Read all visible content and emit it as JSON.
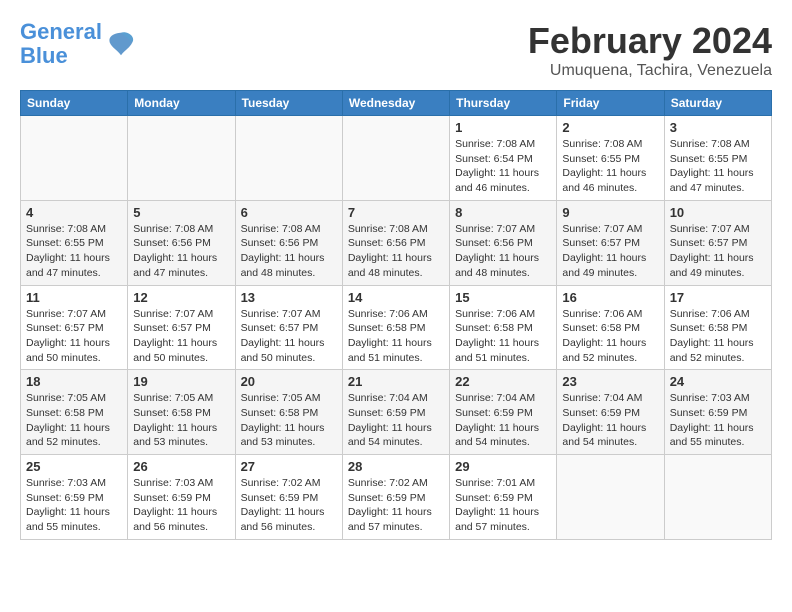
{
  "header": {
    "logo_line1": "General",
    "logo_line2": "Blue",
    "month_title": "February 2024",
    "location": "Umuquena, Tachira, Venezuela"
  },
  "weekdays": [
    "Sunday",
    "Monday",
    "Tuesday",
    "Wednesday",
    "Thursday",
    "Friday",
    "Saturday"
  ],
  "weeks": [
    [
      {
        "day": "",
        "info": ""
      },
      {
        "day": "",
        "info": ""
      },
      {
        "day": "",
        "info": ""
      },
      {
        "day": "",
        "info": ""
      },
      {
        "day": "1",
        "info": "Sunrise: 7:08 AM\nSunset: 6:54 PM\nDaylight: 11 hours and 46 minutes."
      },
      {
        "day": "2",
        "info": "Sunrise: 7:08 AM\nSunset: 6:55 PM\nDaylight: 11 hours and 46 minutes."
      },
      {
        "day": "3",
        "info": "Sunrise: 7:08 AM\nSunset: 6:55 PM\nDaylight: 11 hours and 47 minutes."
      }
    ],
    [
      {
        "day": "4",
        "info": "Sunrise: 7:08 AM\nSunset: 6:55 PM\nDaylight: 11 hours and 47 minutes."
      },
      {
        "day": "5",
        "info": "Sunrise: 7:08 AM\nSunset: 6:56 PM\nDaylight: 11 hours and 47 minutes."
      },
      {
        "day": "6",
        "info": "Sunrise: 7:08 AM\nSunset: 6:56 PM\nDaylight: 11 hours and 48 minutes."
      },
      {
        "day": "7",
        "info": "Sunrise: 7:08 AM\nSunset: 6:56 PM\nDaylight: 11 hours and 48 minutes."
      },
      {
        "day": "8",
        "info": "Sunrise: 7:07 AM\nSunset: 6:56 PM\nDaylight: 11 hours and 48 minutes."
      },
      {
        "day": "9",
        "info": "Sunrise: 7:07 AM\nSunset: 6:57 PM\nDaylight: 11 hours and 49 minutes."
      },
      {
        "day": "10",
        "info": "Sunrise: 7:07 AM\nSunset: 6:57 PM\nDaylight: 11 hours and 49 minutes."
      }
    ],
    [
      {
        "day": "11",
        "info": "Sunrise: 7:07 AM\nSunset: 6:57 PM\nDaylight: 11 hours and 50 minutes."
      },
      {
        "day": "12",
        "info": "Sunrise: 7:07 AM\nSunset: 6:57 PM\nDaylight: 11 hours and 50 minutes."
      },
      {
        "day": "13",
        "info": "Sunrise: 7:07 AM\nSunset: 6:57 PM\nDaylight: 11 hours and 50 minutes."
      },
      {
        "day": "14",
        "info": "Sunrise: 7:06 AM\nSunset: 6:58 PM\nDaylight: 11 hours and 51 minutes."
      },
      {
        "day": "15",
        "info": "Sunrise: 7:06 AM\nSunset: 6:58 PM\nDaylight: 11 hours and 51 minutes."
      },
      {
        "day": "16",
        "info": "Sunrise: 7:06 AM\nSunset: 6:58 PM\nDaylight: 11 hours and 52 minutes."
      },
      {
        "day": "17",
        "info": "Sunrise: 7:06 AM\nSunset: 6:58 PM\nDaylight: 11 hours and 52 minutes."
      }
    ],
    [
      {
        "day": "18",
        "info": "Sunrise: 7:05 AM\nSunset: 6:58 PM\nDaylight: 11 hours and 52 minutes."
      },
      {
        "day": "19",
        "info": "Sunrise: 7:05 AM\nSunset: 6:58 PM\nDaylight: 11 hours and 53 minutes."
      },
      {
        "day": "20",
        "info": "Sunrise: 7:05 AM\nSunset: 6:58 PM\nDaylight: 11 hours and 53 minutes."
      },
      {
        "day": "21",
        "info": "Sunrise: 7:04 AM\nSunset: 6:59 PM\nDaylight: 11 hours and 54 minutes."
      },
      {
        "day": "22",
        "info": "Sunrise: 7:04 AM\nSunset: 6:59 PM\nDaylight: 11 hours and 54 minutes."
      },
      {
        "day": "23",
        "info": "Sunrise: 7:04 AM\nSunset: 6:59 PM\nDaylight: 11 hours and 54 minutes."
      },
      {
        "day": "24",
        "info": "Sunrise: 7:03 AM\nSunset: 6:59 PM\nDaylight: 11 hours and 55 minutes."
      }
    ],
    [
      {
        "day": "25",
        "info": "Sunrise: 7:03 AM\nSunset: 6:59 PM\nDaylight: 11 hours and 55 minutes."
      },
      {
        "day": "26",
        "info": "Sunrise: 7:03 AM\nSunset: 6:59 PM\nDaylight: 11 hours and 56 minutes."
      },
      {
        "day": "27",
        "info": "Sunrise: 7:02 AM\nSunset: 6:59 PM\nDaylight: 11 hours and 56 minutes."
      },
      {
        "day": "28",
        "info": "Sunrise: 7:02 AM\nSunset: 6:59 PM\nDaylight: 11 hours and 57 minutes."
      },
      {
        "day": "29",
        "info": "Sunrise: 7:01 AM\nSunset: 6:59 PM\nDaylight: 11 hours and 57 minutes."
      },
      {
        "day": "",
        "info": ""
      },
      {
        "day": "",
        "info": ""
      }
    ]
  ]
}
